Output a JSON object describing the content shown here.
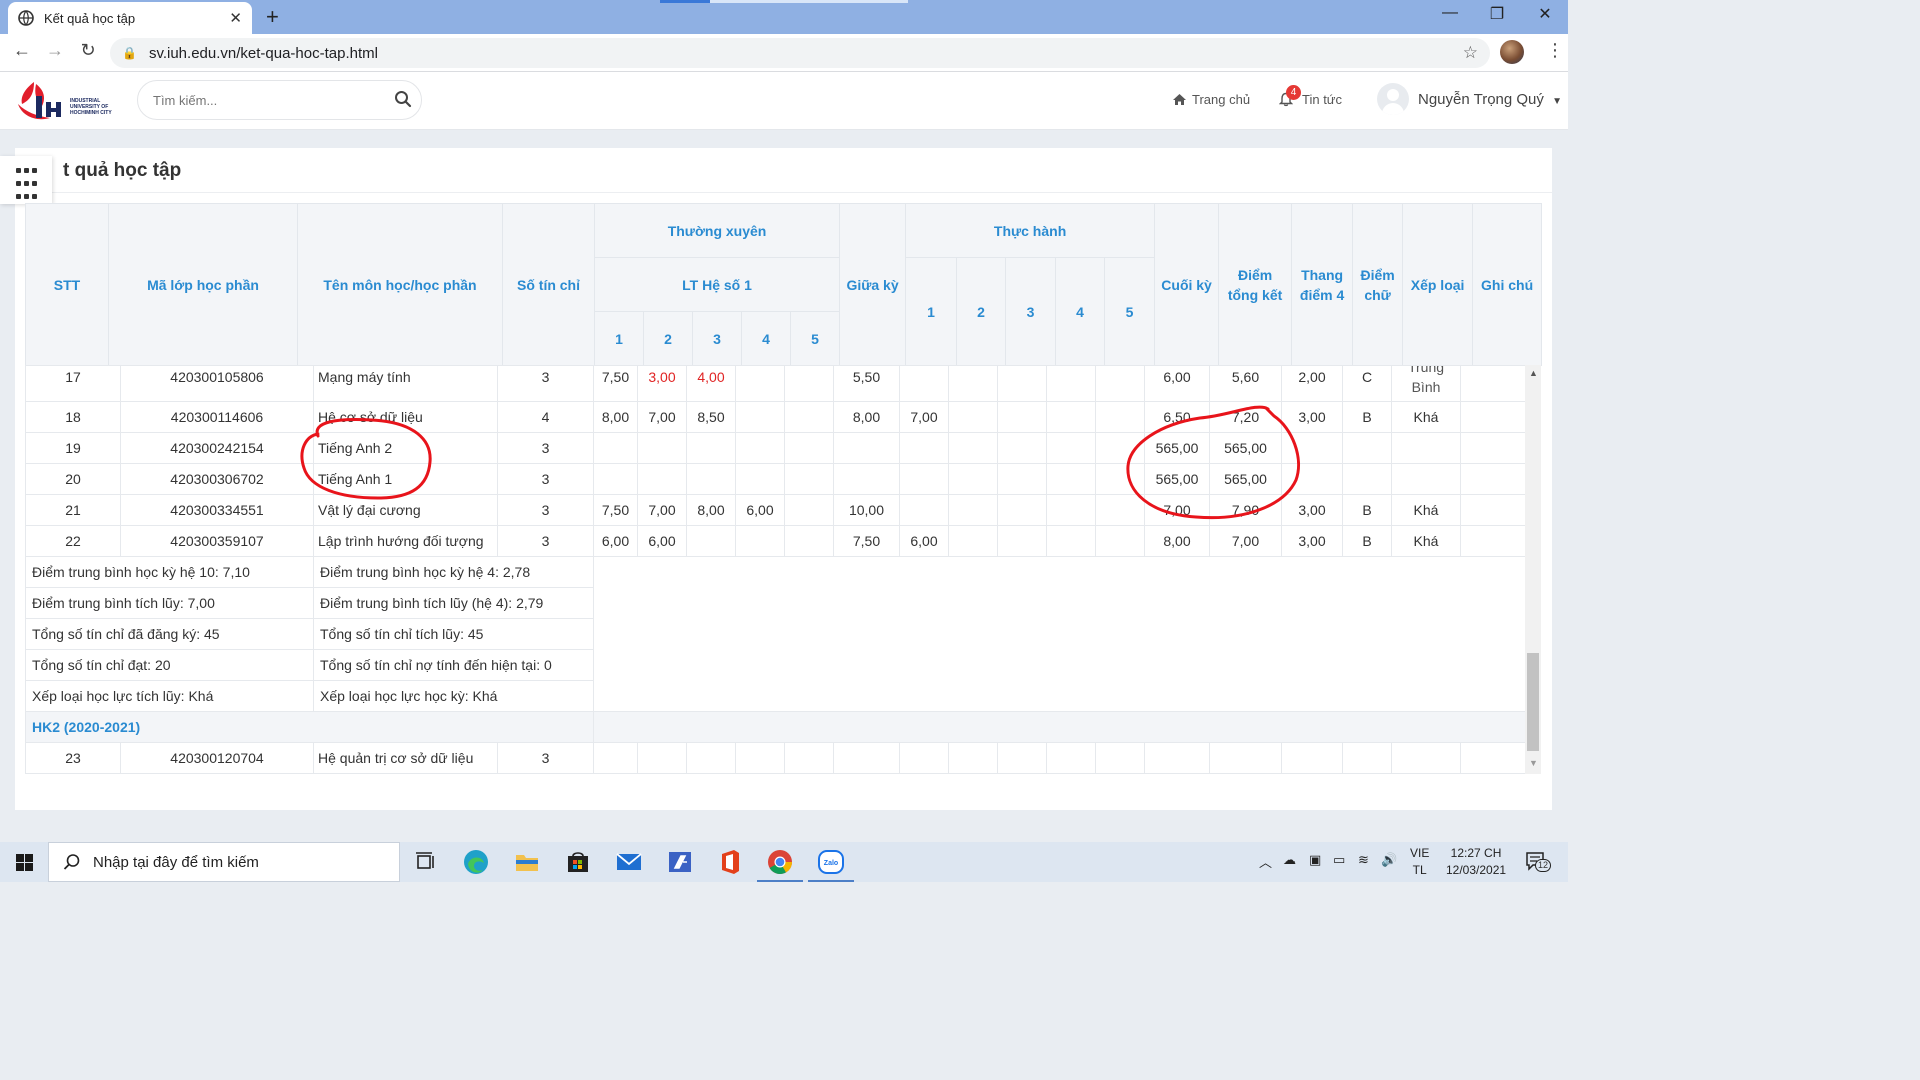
{
  "browser": {
    "tab_title": "Kết quả học tập",
    "url": "sv.iuh.edu.vn/ket-qua-hoc-tap.html"
  },
  "site_header": {
    "logo_text": [
      "INDUSTRIAL",
      "UNIVERSITY OF",
      "HOCHIMINH CITY"
    ],
    "search_placeholder": "Tìm kiếm...",
    "nav_home": "Trang chủ",
    "nav_news": "Tin tức",
    "news_badge": "4",
    "user_name": "Nguyễn Trọng Quý"
  },
  "page": {
    "title": "t quả học tập"
  },
  "table_header": {
    "stt": "STT",
    "ma_lop": "Mã lớp học phần",
    "ten_mon": "Tên môn học/học phần",
    "so_tin_chi": "Số tín chỉ",
    "thuong_xuyen": "Thường xuyên",
    "lt_he_so": "LT Hệ số 1",
    "giua_ky": "Giữa kỳ",
    "thuc_hanh": "Thực hành",
    "cuoi_ky": "Cuối kỳ",
    "diem_tong_ket_1": "Điểm",
    "diem_tong_ket_2": "tổng kết",
    "thang_diem_1": "Thang",
    "thang_diem_2": "điểm 4",
    "diem_chu_1": "Điểm",
    "diem_chu_2": "chữ",
    "xep_loai": "Xếp loại",
    "ghi_chu": "Ghi chú",
    "sub_numbers": [
      "1",
      "2",
      "3",
      "4",
      "5"
    ]
  },
  "rows": [
    {
      "stt": "17",
      "ma": "420300105806",
      "ten": "Mạng máy tính",
      "tc": "3",
      "tx": [
        "7,50",
        "3,00",
        "4,00",
        "",
        ""
      ],
      "gk": "5,50",
      "th": [
        "",
        "",
        "",
        "",
        ""
      ],
      "ck": "6,00",
      "tk": "5,60",
      "t4": "2,00",
      "chu": "C",
      "xl": [
        "Trung",
        "Bình"
      ],
      "gc": ""
    },
    {
      "stt": "18",
      "ma": "420300114606",
      "ten": "Hệ cơ sở dữ liệu",
      "tc": "4",
      "tx": [
        "8,00",
        "7,00",
        "8,50",
        "",
        ""
      ],
      "gk": "8,00",
      "th": [
        "7,00",
        "",
        "",
        "",
        ""
      ],
      "ck": "6,50",
      "tk": "7,20",
      "t4": "3,00",
      "chu": "B",
      "xl": "Khá",
      "gc": ""
    },
    {
      "stt": "19",
      "ma": "420300242154",
      "ten": "Tiếng Anh 2",
      "tc": "3",
      "tx": [
        "",
        "",
        "",
        "",
        ""
      ],
      "gk": "",
      "th": [
        "",
        "",
        "",
        "",
        ""
      ],
      "ck": "565,00",
      "tk": "565,00",
      "t4": "",
      "chu": "",
      "xl": "",
      "gc": ""
    },
    {
      "stt": "20",
      "ma": "420300306702",
      "ten": "Tiếng Anh 1",
      "tc": "3",
      "tx": [
        "",
        "",
        "",
        "",
        ""
      ],
      "gk": "",
      "th": [
        "",
        "",
        "",
        "",
        ""
      ],
      "ck": "565,00",
      "tk": "565,00",
      "t4": "",
      "chu": "",
      "xl": "",
      "gc": ""
    },
    {
      "stt": "21",
      "ma": "420300334551",
      "ten": "Vật lý đại cương",
      "tc": "3",
      "tx": [
        "7,50",
        "7,00",
        "8,00",
        "6,00",
        ""
      ],
      "gk": "10,00",
      "th": [
        "",
        "",
        "",
        "",
        ""
      ],
      "ck": "7,00",
      "tk": "7,90",
      "t4": "3,00",
      "chu": "B",
      "xl": "Khá",
      "gc": ""
    },
    {
      "stt": "22",
      "ma": "420300359107",
      "ten": "Lập trình hướng đối tượng",
      "tc": "3",
      "tx": [
        "6,00",
        "6,00",
        "",
        "",
        ""
      ],
      "gk": "7,50",
      "th": [
        "6,00",
        "",
        "",
        "",
        ""
      ],
      "ck": "8,00",
      "tk": "7,00",
      "t4": "3,00",
      "chu": "B",
      "xl": "Khá",
      "gc": ""
    }
  ],
  "summary": [
    [
      "Điểm trung bình học kỳ hệ 10: 7,10",
      "Điểm trung bình học kỳ hệ 4: 2,78"
    ],
    [
      "Điểm trung bình tích lũy: 7,00",
      "Điểm trung bình tích lũy (hệ 4): 2,79"
    ],
    [
      "Tổng số tín chỉ đã đăng ký: 45",
      "Tổng số tín chỉ tích lũy: 45"
    ],
    [
      "Tổng số tín chỉ đạt: 20",
      "Tổng số tín chỉ nợ tính đến hiện tại: 0"
    ],
    [
      "Xếp loại học lực tích lũy: Khá",
      "Xếp loại học lực học kỳ: Khá"
    ]
  ],
  "semester_label": "HK2 (2020-2021)",
  "row23": {
    "stt": "23",
    "ma": "420300120704",
    "ten": "Hệ quản trị cơ sở dữ liệu",
    "tc": "3"
  },
  "taskbar": {
    "search_text": "Nhập tại đây để tìm kiếm",
    "lang_1": "VIE",
    "lang_2": "TL",
    "time": "12:27 CH",
    "date": "12/03/2021",
    "notif_count": "12"
  },
  "colors": {
    "header_blue": "#2a8bd1",
    "low_score_red": "#e02424",
    "annotation_red": "#e8141b"
  }
}
